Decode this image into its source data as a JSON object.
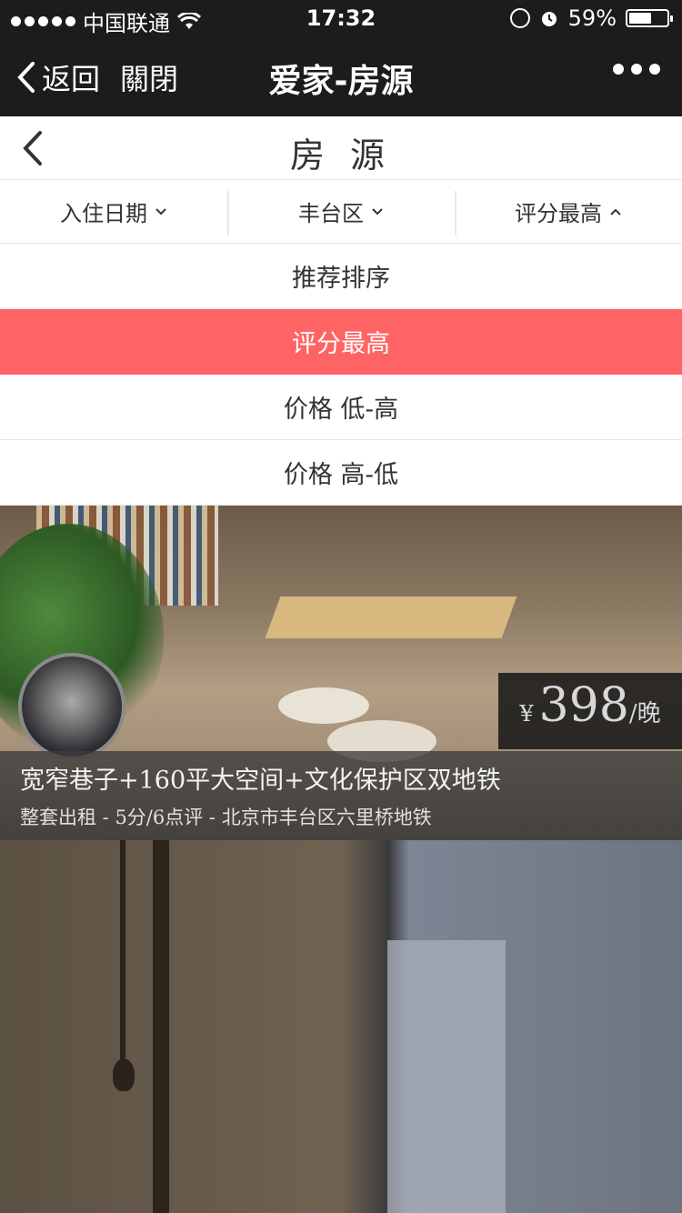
{
  "status_bar": {
    "carrier": "中国联通",
    "time": "17:32",
    "battery_percent": "59%",
    "battery_level": 0.59
  },
  "nav_bar": {
    "back_label": "返回",
    "close_label": "關閉",
    "title": "爱家-房源"
  },
  "page_header": {
    "title": "房 源"
  },
  "filters": [
    {
      "label": "入住日期",
      "arrow": "chevron-down"
    },
    {
      "label": "丰台区",
      "arrow": "chevron-down"
    },
    {
      "label": "评分最高",
      "arrow": "chevron-up"
    }
  ],
  "sort_options": [
    {
      "label": "推荐排序",
      "selected": false
    },
    {
      "label": "评分最高",
      "selected": true
    },
    {
      "label": "价格 低-高",
      "selected": false
    },
    {
      "label": "价格 高-低",
      "selected": false
    }
  ],
  "listings": [
    {
      "title": "宽窄巷子+160平大空间+文化保护区双地铁",
      "meta": "整套出租 - 5分/6点评 - 北京市丰台区六里桥地铁",
      "price_currency": "¥",
      "price": "398",
      "price_unit": "/晚"
    }
  ],
  "colors": {
    "active_sort": "#ff6464",
    "nav_bg": "#1c1c1e"
  }
}
